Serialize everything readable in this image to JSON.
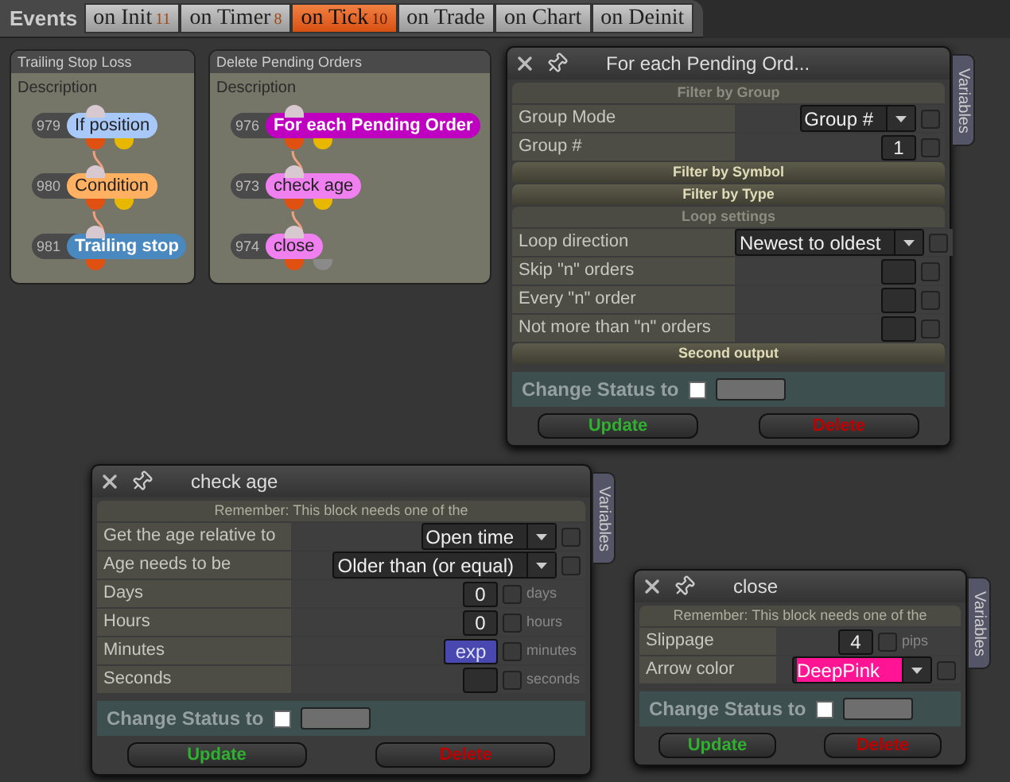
{
  "tab_bar": {
    "label": "Events",
    "tabs": [
      {
        "label": "on Init",
        "count": "11",
        "selected": false
      },
      {
        "label": "on Timer",
        "count": "8",
        "selected": false
      },
      {
        "label": "on Tick",
        "count": "10",
        "selected": true
      },
      {
        "label": "on Trade",
        "selected": false
      },
      {
        "label": "on Chart",
        "selected": false
      },
      {
        "label": "on Deinit",
        "selected": false
      }
    ]
  },
  "canvas_panels": [
    {
      "title": "Trailing Stop Loss",
      "description": "Description",
      "blocks": [
        {
          "number": "979",
          "label": "If position",
          "color": "#a8c8f8",
          "second_output": true,
          "second_output_active": true
        },
        {
          "number": "980",
          "label": "Condition",
          "color": "#ffb060",
          "second_output": true,
          "second_output_active": true
        },
        {
          "number": "981",
          "label": "Trailing stop",
          "color": "#4a88c0",
          "second_output": false
        }
      ]
    },
    {
      "title": "Delete Pending Orders",
      "description": "Description",
      "blocks": [
        {
          "number": "976",
          "label": "For each Pending Order",
          "color": "#c000c0",
          "second_output": true,
          "second_output_active": true
        },
        {
          "number": "973",
          "label": "check age",
          "color": "#f080f0",
          "second_output": true,
          "second_output_active": true
        },
        {
          "number": "974",
          "label": "close",
          "color": "#f080f0",
          "second_output": true,
          "second_output_active": false
        }
      ]
    }
  ],
  "dialogs": [
    {
      "title": "For each Pending Ord...",
      "side_tab": "Variables",
      "sections": [
        {
          "kind": "header",
          "label": "Filter by Group",
          "expanded": true
        },
        {
          "kind": "select",
          "label": "Group Mode",
          "value": "Group #",
          "checked": false
        },
        {
          "kind": "number",
          "label": "Group #",
          "value": "1",
          "checked": false
        },
        {
          "kind": "header",
          "label": "Filter by Symbol",
          "expanded": false
        },
        {
          "kind": "header",
          "label": "Filter by Type",
          "expanded": false
        },
        {
          "kind": "header",
          "label": "Loop settings",
          "expanded": true
        },
        {
          "kind": "select",
          "label": "Loop direction",
          "value": "Newest to oldest",
          "checked": false
        },
        {
          "kind": "number",
          "label": "Skip \"n\" orders",
          "checked": false
        },
        {
          "kind": "number",
          "label": "Every \"n\" order",
          "checked": false
        },
        {
          "kind": "number",
          "label": "Not more than \"n\" orders",
          "checked": false
        },
        {
          "kind": "header",
          "label": "Second output",
          "expanded": false
        }
      ],
      "status": {
        "label": "Change Status to",
        "checked": false
      },
      "buttons": [
        {
          "label": "Update",
          "kind": "update"
        },
        {
          "label": "Delete",
          "kind": "delete"
        }
      ]
    },
    {
      "title": "check age",
      "side_tab": "Variables",
      "sections": [
        {
          "kind": "note",
          "label": "Remember: This block needs one of the"
        },
        {
          "kind": "select",
          "label": "Get the age relative to",
          "value": "Open time",
          "checked": false
        },
        {
          "kind": "select",
          "label": "Age needs to be",
          "value": "Older than (or equal)",
          "checked": false
        },
        {
          "kind": "number",
          "label": "Days",
          "value": "0",
          "checked": false,
          "unit": "days"
        },
        {
          "kind": "number",
          "label": "Hours",
          "value": "0",
          "checked": false,
          "unit": "hours"
        },
        {
          "kind": "expression",
          "label": "Minutes",
          "value": "exp",
          "checked": false,
          "unit": "minutes"
        },
        {
          "kind": "number",
          "label": "Seconds",
          "checked": false,
          "unit": "seconds"
        }
      ],
      "status": {
        "label": "Change Status to",
        "checked": false
      },
      "buttons": [
        {
          "label": "Update",
          "kind": "update"
        },
        {
          "label": "Delete",
          "kind": "delete"
        }
      ]
    },
    {
      "title": "close",
      "side_tab": "Variables",
      "sections": [
        {
          "kind": "note",
          "label": "Remember: This block needs one of the"
        },
        {
          "kind": "number",
          "label": "Slippage",
          "value": "4",
          "checked": false,
          "unit": "pips"
        },
        {
          "kind": "color-select",
          "label": "Arrow color",
          "value": "DeepPink",
          "color": "#ff1493",
          "checked": false
        }
      ],
      "status": {
        "label": "Change Status to",
        "checked": false
      },
      "buttons": [
        {
          "label": "Update",
          "kind": "update"
        },
        {
          "label": "Delete",
          "kind": "delete"
        }
      ]
    }
  ]
}
